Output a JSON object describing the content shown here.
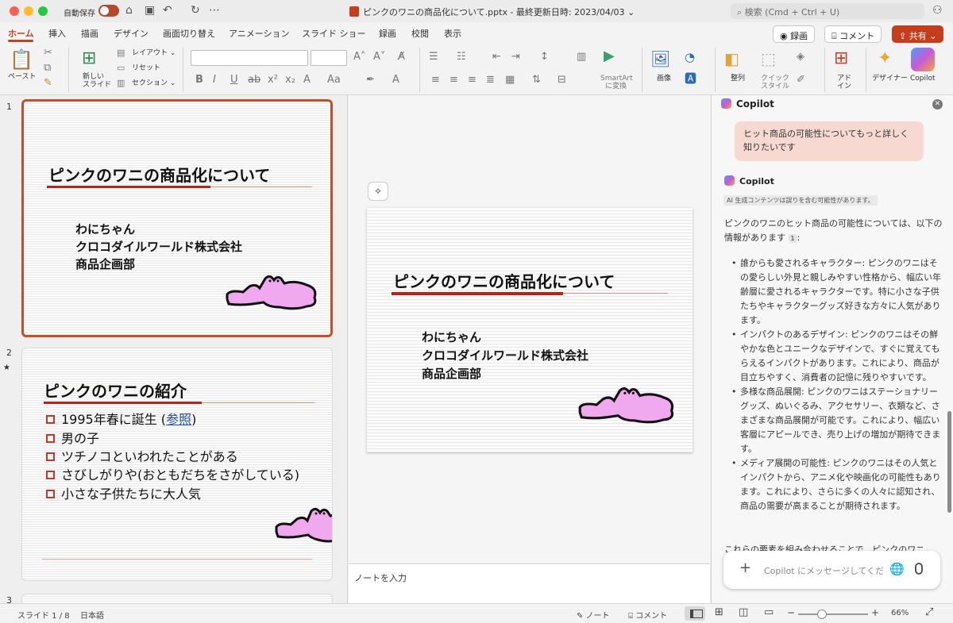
{
  "titlebar": {
    "autosave_label": "自動保存",
    "doc_title": "ピンクのワニの商品化について.pptx - 最終更新日時: 2023/04/03 ⌄",
    "search_placeholder": "検索 (Cmd + Ctrl + U)"
  },
  "ribbon_tabs": [
    "ホーム",
    "挿入",
    "描画",
    "デザイン",
    "画面切り替え",
    "アニメーション",
    "スライド ショー",
    "録画",
    "校閲",
    "表示"
  ],
  "top_buttons": {
    "record": "◉ 録画",
    "comment": "⌸ コメント",
    "share": "⇪ 共有 ⌄"
  },
  "ribbon": {
    "paste": "ペースト",
    "new_slide_line1": "新しい",
    "new_slide_line2": "スライド",
    "layout": "レイアウト ⌄",
    "reset": "リセット",
    "section": "セクション ⌄",
    "smartart_line1": "SmartArt",
    "smartart_line2": "に変換",
    "image": "画像",
    "arrange": "整列",
    "quick_style_line1": "クイック",
    "quick_style_line2": "スタイル",
    "addin_line1": "アド",
    "addin_line2": "イン",
    "designer": "デザイナー",
    "copilot": "Copilot"
  },
  "slides": {
    "slide1": {
      "number": "1",
      "title": "ピンクのワニの商品化について",
      "lines": [
        "わにちゃん",
        "クロコダイルワールド株式会社",
        "商品企画部"
      ]
    },
    "slide2": {
      "number": "2",
      "star": "★",
      "title": "ピンクのワニの紹介",
      "bullet1_text": "1995年春に誕生 (",
      "bullet1_link": "参照",
      "bullet1_close": ")",
      "bullets": [
        "男の子",
        "ツチノコといわれたことがある",
        "さびしがりや(おともだちをさがしている)",
        "小さな子供たちに大人気"
      ]
    },
    "slide3": {
      "number": "3"
    }
  },
  "notes_placeholder": "ノートを入力",
  "copilot": {
    "header": "Copilot",
    "user_message": "ヒット商品の可能性についてもっと詳しく知りたいです",
    "responder": "Copilot",
    "ai_note": "AI 生成コンテンツは誤りを含む可能性があります。",
    "intro": "ピンクのワニのヒット商品の可能性については、以下の情報があります",
    "ref": "1",
    "intro_end": ":",
    "points": [
      "誰からも愛されるキャラクター: ピンクのワニはその愛らしい外見と親しみやすい性格から、幅広い年齢層に愛されるキャラクターです。特に小さな子供たちやキャラクターグッズ好きな方々に人気があります。",
      "インパクトのあるデザイン: ピンクのワニはその鮮やかな色とユニークなデザインで、すぐに覚えてもらえるインパクトがあります。これにより、商品が目立ちやすく、消費者の記憶に残りやすいです。",
      "多様な商品展開: ピンクのワニはステーショナリーグッズ、ぬいぐるみ、アクセサリー、衣類など、さまざまな商品展開が可能です。これにより、幅広い客層にアピールでき、売り上げの増加が期待できます。",
      "メディア展開の可能性: ピンクのワニはその人気とインパクトから、アニメ化や映画化の可能性もあります。これにより、さらに多くの人々に認知され、商品の需要が高まることが期待されます。"
    ],
    "cut_text": "これらの要素を組み合わせることで、ピンクのワニ",
    "input_placeholder": "Copilot にメッセージしてください"
  },
  "status": {
    "slide_count": "スライド 1 / 8",
    "language": "日本語",
    "notes": "✎ ノート",
    "comments": "⌸ コメント",
    "zoom": "66%"
  },
  "colors": {
    "accent": "#b7472a",
    "croc_pink": "#f0a8ee",
    "title_bar_red": "#b32519"
  }
}
